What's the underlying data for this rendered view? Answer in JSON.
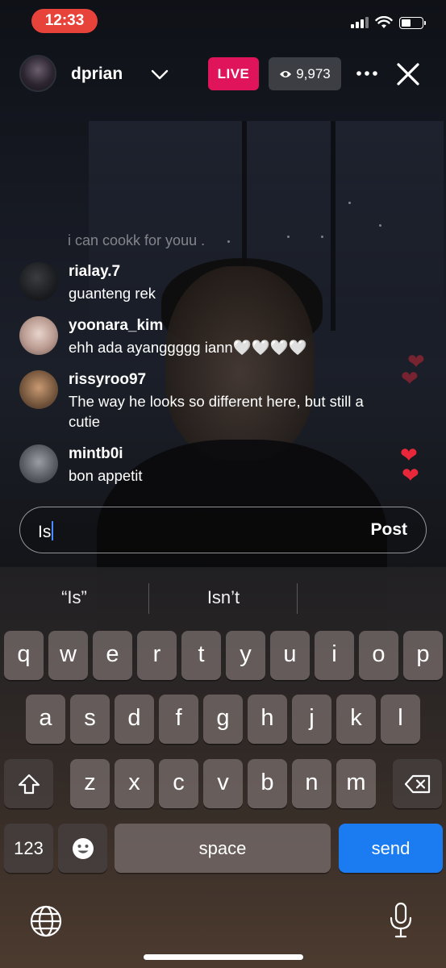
{
  "status_bar": {
    "time": "12:33"
  },
  "header": {
    "username": "dprian",
    "live_label": "LIVE",
    "viewer_count": "9,973"
  },
  "comments": {
    "faded": "i can cookk for youu .",
    "items": [
      {
        "user": "rialay.7",
        "text": "guanteng rek"
      },
      {
        "user": "yoonara_kim",
        "text": "ehh ada ayanggggg iann🤍🤍🤍🤍"
      },
      {
        "user": "rissyroo97",
        "text": "The way he looks so different here, but still a cutie"
      },
      {
        "user": "mintb0i",
        "text": "bon appetit"
      }
    ]
  },
  "input": {
    "value": "Is",
    "post_label": "Post"
  },
  "keyboard": {
    "suggestions": [
      "“Is”",
      "Isn’t",
      ""
    ],
    "row1": [
      "q",
      "w",
      "e",
      "r",
      "t",
      "y",
      "u",
      "i",
      "o",
      "p"
    ],
    "row2": [
      "a",
      "s",
      "d",
      "f",
      "g",
      "h",
      "j",
      "k",
      "l"
    ],
    "row3": [
      "z",
      "x",
      "c",
      "v",
      "b",
      "n",
      "m"
    ],
    "numbers_label": "123",
    "space_label": "space",
    "send_label": "send"
  },
  "colors": {
    "time_pill": "#e8433a",
    "live_badge": "#e0145a",
    "send_key": "#1b7cf2",
    "heart": "#e8283a"
  },
  "icons": [
    "eye-icon",
    "chevron-down-icon",
    "more-icon",
    "close-icon",
    "shift-icon",
    "backspace-icon",
    "emoji-icon",
    "globe-icon",
    "microphone-icon",
    "heart-icon",
    "wifi-icon",
    "signal-icon",
    "battery-icon"
  ]
}
